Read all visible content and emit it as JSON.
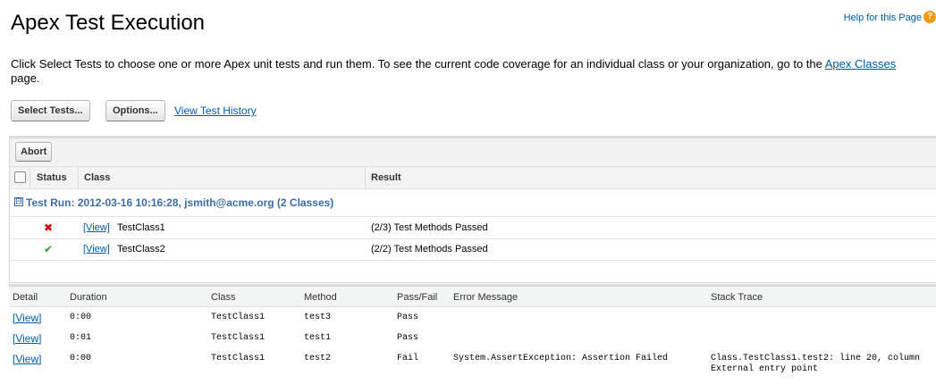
{
  "header": {
    "title": "Apex Test Execution",
    "help_link": "Help for this Page",
    "help_icon": "?"
  },
  "intro": {
    "text_before": "Click Select Tests to choose one or more Apex unit tests and run them. To see the current code coverage for an individual class or your organization, go to the ",
    "link": "Apex Classes",
    "text_after": " page."
  },
  "actions": {
    "select_tests": "Select Tests...",
    "options": "Options...",
    "view_history": "View Test History"
  },
  "run_panel": {
    "abort": "Abort",
    "columns": {
      "status": "Status",
      "class": "Class",
      "result": "Result"
    },
    "group": {
      "collapse_symbol": "⊟",
      "label": "Test Run: 2012-03-16 10:16:28, jsmith@acme.org (2 Classes)"
    },
    "rows": [
      {
        "status_icon": "✖",
        "status": "fail",
        "view": "[View]",
        "class": "TestClass1",
        "result": "(2/3) Test Methods Passed"
      },
      {
        "status_icon": "✔",
        "status": "pass",
        "view": "[View]",
        "class": "TestClass2",
        "result": "(2/2) Test Methods Passed"
      }
    ]
  },
  "detail": {
    "columns": {
      "detail": "Detail",
      "duration": "Duration",
      "class": "Class",
      "method": "Method",
      "pass_fail": "Pass/Fail",
      "error": "Error Message",
      "stack": "Stack Trace"
    },
    "rows": [
      {
        "view": "[View]",
        "duration": "0:00",
        "class": "TestClass1",
        "method": "test3",
        "result": "Pass",
        "error": "",
        "stack": "",
        "stack2": ""
      },
      {
        "view": "[View]",
        "duration": "0:01",
        "class": "TestClass1",
        "method": "test1",
        "result": "Pass",
        "error": "",
        "stack": "",
        "stack2": ""
      },
      {
        "view": "[View]",
        "duration": "0:00",
        "class": "TestClass1",
        "method": "test2",
        "result": "Fail",
        "error": "System.AssertException: Assertion Failed",
        "stack": "Class.TestClass1.test2: line 20, column",
        "stack2": "External entry point"
      }
    ]
  }
}
